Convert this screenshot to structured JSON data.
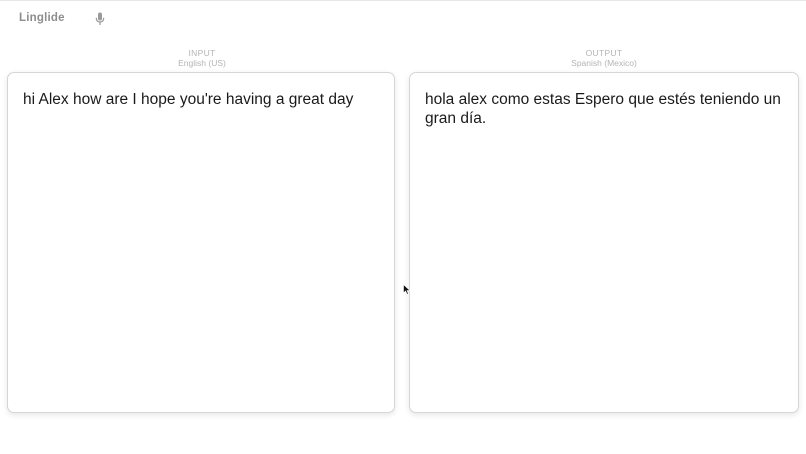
{
  "app": {
    "brand": "Linglide",
    "mic_icon": "microphone-icon"
  },
  "input": {
    "role": "INPUT",
    "language": "English (US)",
    "text": "hi Alex how are I hope you're having a great day"
  },
  "output": {
    "role": "OUTPUT",
    "language": "Spanish (Mexico)",
    "text": "hola alex como estas Espero que estés teniendo un gran día."
  },
  "colors": {
    "muted": "#b4b4b4",
    "brand": "#8d8d8d",
    "text": "#1a1a1a",
    "panel_border": "#d6d6d6"
  }
}
